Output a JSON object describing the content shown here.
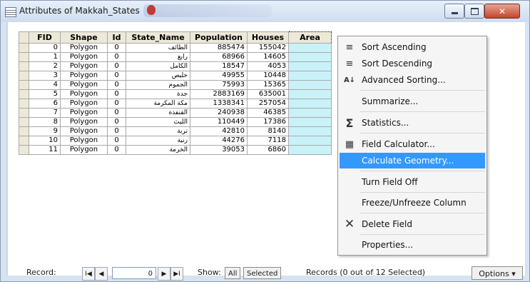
{
  "window": {
    "title": "Attributes of Makkah_States"
  },
  "table": {
    "columns": [
      "FID",
      "Shape",
      "Id",
      "State_Name",
      "Population",
      "Houses",
      "Area"
    ],
    "rows": [
      {
        "fid": "0",
        "shape": "Polygon",
        "id": "0",
        "state_name": "الطائف",
        "population": "885474",
        "houses": "155042"
      },
      {
        "fid": "1",
        "shape": "Polygon",
        "id": "0",
        "state_name": "رابغ",
        "population": "68966",
        "houses": "14605"
      },
      {
        "fid": "2",
        "shape": "Polygon",
        "id": "0",
        "state_name": "الكامل",
        "population": "18547",
        "houses": "4053"
      },
      {
        "fid": "3",
        "shape": "Polygon",
        "id": "0",
        "state_name": "خليص",
        "population": "49955",
        "houses": "10448"
      },
      {
        "fid": "4",
        "shape": "Polygon",
        "id": "0",
        "state_name": "الجموم",
        "population": "75993",
        "houses": "15365"
      },
      {
        "fid": "5",
        "shape": "Polygon",
        "id": "0",
        "state_name": "جدة",
        "population": "2883169",
        "houses": "635001"
      },
      {
        "fid": "6",
        "shape": "Polygon",
        "id": "0",
        "state_name": "مكة المكرمة",
        "population": "1338341",
        "houses": "257054"
      },
      {
        "fid": "7",
        "shape": "Polygon",
        "id": "0",
        "state_name": "القنفذة",
        "population": "240938",
        "houses": "46385"
      },
      {
        "fid": "8",
        "shape": "Polygon",
        "id": "0",
        "state_name": "الليث",
        "population": "110449",
        "houses": "17386"
      },
      {
        "fid": "9",
        "shape": "Polygon",
        "id": "0",
        "state_name": "تربة",
        "population": "42810",
        "houses": "8140"
      },
      {
        "fid": "10",
        "shape": "Polygon",
        "id": "0",
        "state_name": "رنية",
        "population": "44276",
        "houses": "7118"
      },
      {
        "fid": "11",
        "shape": "Polygon",
        "id": "0",
        "state_name": "الخرمة",
        "population": "39053",
        "houses": "6860"
      }
    ]
  },
  "context_menu": {
    "items": [
      {
        "label": "Sort Ascending",
        "icon": "sort-ascending-icon"
      },
      {
        "label": "Sort Descending",
        "icon": "sort-descending-icon"
      },
      {
        "label": "Advanced Sorting...",
        "icon": "advanced-sort-icon"
      },
      {
        "label": "Summarize...",
        "icon": ""
      },
      {
        "label": "Statistics...",
        "icon": "sigma-icon"
      },
      {
        "label": "Field Calculator...",
        "icon": "calculator-icon"
      },
      {
        "label": "Calculate Geometry...",
        "icon": "",
        "highlighted": true
      },
      {
        "label": "Turn Field Off",
        "icon": ""
      },
      {
        "label": "Freeze/Unfreeze Column",
        "icon": ""
      },
      {
        "label": "Delete Field",
        "icon": "delete-x-icon"
      },
      {
        "label": "Properties...",
        "icon": ""
      }
    ]
  },
  "footer": {
    "record_label": "Record:",
    "record_value": "0",
    "show_label": "Show:",
    "all_label": "All",
    "selected_label": "Selected",
    "records_status": "Records (0 out of 12 Selected)",
    "options_label": "Options"
  },
  "colors": {
    "highlight": "#3399ff",
    "area_column": "#c8f2f8",
    "title_bar": "#d6e3f2",
    "close_button": "#c4442b"
  }
}
